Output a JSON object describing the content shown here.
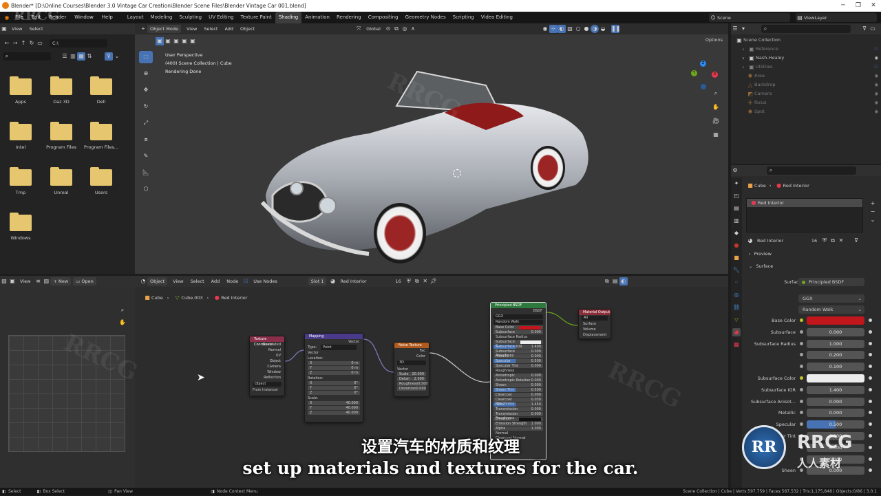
{
  "title_bar": {
    "text": "Blender* [D:\\Online Courses\\Blender 3.0 Vintage Car Creation\\Blender Scene Files\\Blender Vintage Car 001.blend]"
  },
  "menubar": {
    "menus": [
      "File",
      "Edit",
      "Render",
      "Window",
      "Help"
    ],
    "workspaces": [
      "Layout",
      "Modeling",
      "Sculpting",
      "UV Editing",
      "Texture Paint",
      "Shading",
      "Animation",
      "Rendering",
      "Compositing",
      "Geometry Nodes",
      "Scripting",
      "Video Editing"
    ],
    "active_workspace": "Shading",
    "scene": "Scene",
    "view_layer": "ViewLayer"
  },
  "file_browser": {
    "menu": [
      "View",
      "Select"
    ],
    "path": "C:\\",
    "folders": [
      "Apps",
      "Daz 3D",
      "Dell",
      "Intel",
      "Program Files",
      "Program Files...",
      "Tmp",
      "Unreal",
      "Users",
      "Windows"
    ]
  },
  "viewport": {
    "mode": "Object Mode",
    "menu": [
      "View",
      "Select",
      "Add",
      "Object"
    ],
    "transform": "Global",
    "options": "Options",
    "overlay_lines": [
      "User Perspective",
      "(400) Scene Collection | Cube",
      "Rendering Done"
    ],
    "gizmo_axes": {
      "x": "X",
      "y": "Y",
      "z": "Z"
    }
  },
  "outliner": {
    "root": "Scene Collection",
    "items": [
      "Reference",
      "Nash-Healey",
      "Utilities",
      "Area",
      "Backdrop",
      "Camera",
      "focus",
      "Spot"
    ]
  },
  "properties": {
    "breadcrumb": [
      "Cube",
      "Red Interior"
    ],
    "material_slot": "Red Interior",
    "material_name": "Red Interior",
    "users": "16",
    "sections": {
      "preview": "Preview",
      "surface": "Surface"
    },
    "surface_shader_label": "Surface",
    "surface_shader": "Principled BSDF",
    "distribution": "GGX",
    "subsurface_method": "Random Walk",
    "fields": [
      {
        "label": "Base Color",
        "type": "color",
        "color": "#c0161c"
      },
      {
        "label": "Subsurface",
        "value": "0.000"
      },
      {
        "label": "Subsurface Radius",
        "value": "1.000"
      },
      {
        "label": "",
        "value": "0.200"
      },
      {
        "label": "",
        "value": "0.100"
      },
      {
        "label": "Subsurface Color",
        "type": "color",
        "color": "#ececec"
      },
      {
        "label": "Subsurface IOR",
        "value": "1.400"
      },
      {
        "label": "Subsurface Anisot...",
        "value": "0.000"
      },
      {
        "label": "Metallic",
        "value": "0.000"
      },
      {
        "label": "Specular",
        "value": "0.500",
        "highlight": true
      },
      {
        "label": "Specular Tint",
        "value": "0.000"
      },
      {
        "label": "",
        "value": "0.000"
      },
      {
        "label": "",
        "value": "0.000"
      },
      {
        "label": "Sheen",
        "value": "0.000"
      }
    ]
  },
  "node_editor": {
    "object_menu": "Object",
    "menu": [
      "View",
      "Select",
      "Add",
      "Node"
    ],
    "use_nodes": "Use Nodes",
    "slot": "Slot 1",
    "material": "Red Interior",
    "users": "16",
    "breadcrumb": [
      "Cube",
      "Cube.003",
      "Red Interior"
    ],
    "nodes": {
      "texcoord": {
        "title": "Texture Coordinate",
        "outputs": [
          "Generated",
          "Normal",
          "UV",
          "Object",
          "Camera",
          "Window",
          "Reflection"
        ],
        "object": "Object",
        "from_instancer": "From Instancer"
      },
      "mapping": {
        "title": "Mapping",
        "output": "Vector",
        "type_label": "Type:",
        "type_value": "Point",
        "input": "Vector",
        "location": "Location:",
        "rotation": "Rotation:",
        "scale": "Scale:",
        "loc": [
          "0 m",
          "0 m",
          "0 m"
        ],
        "rot": [
          "0°",
          "0°",
          "0°"
        ],
        "scl": [
          "40.000",
          "40.000",
          "40.000"
        ],
        "axes": [
          "X",
          "Y",
          "Z"
        ]
      },
      "noise": {
        "title": "Noise Texture",
        "outputs": [
          "Fac",
          "Color"
        ],
        "dim": "3D",
        "input": "Vector",
        "params": [
          [
            "Scale",
            "20.000"
          ],
          [
            "Detail",
            "2.000"
          ],
          [
            "Roughness",
            "0.500"
          ],
          [
            "Distortion",
            "0.000"
          ]
        ]
      },
      "bsdf": {
        "title": "Principled BSDF",
        "output": "BSDF",
        "dist": "GGX",
        "method": "Random Walk",
        "rows": [
          [
            "Base Color",
            ""
          ],
          [
            "Subsurface",
            "0.000"
          ],
          [
            "Subsurface Radius",
            ""
          ],
          [
            "Subsurface C...",
            ""
          ],
          [
            "Subsurface IOR",
            "1.400"
          ],
          [
            "Subsurface Anisotropy",
            "0.000"
          ],
          [
            "Metallic",
            "0.000"
          ],
          [
            "Specular",
            "0.500"
          ],
          [
            "Specular Tint",
            "0.000"
          ],
          [
            "Roughness",
            ""
          ],
          [
            "Anisotropic",
            "0.000"
          ],
          [
            "Anisotropic Rotation",
            "0.000"
          ],
          [
            "Sheen",
            "0.000"
          ],
          [
            "Sheen Tint",
            "0.500"
          ],
          [
            "Clearcoat",
            "0.000"
          ],
          [
            "Clearcoat Roughness",
            "0.030"
          ],
          [
            "IOR",
            "1.450"
          ],
          [
            "Transmission",
            "0.000"
          ],
          [
            "Transmission Roughness",
            "0.000"
          ],
          [
            "Emission",
            ""
          ],
          [
            "Emission Strength",
            "1.000"
          ],
          [
            "Alpha",
            "1.000"
          ],
          [
            "Normal",
            ""
          ],
          [
            "Clearcoat Normal",
            ""
          ]
        ]
      },
      "output": {
        "title": "Material Output",
        "target": "All",
        "inputs": [
          "Surface",
          "Volume",
          "Displacement"
        ]
      }
    }
  },
  "left_bottom": {
    "menu": [
      "View"
    ],
    "new_label": "New",
    "open_label": "Open"
  },
  "status_bar": {
    "left": [
      "Select",
      "Box Select",
      "Pan View",
      "Node Context Menu"
    ],
    "right": "Scene Collection | Cube | Verts:597,759 | Faces:587,532 | Tris:1,175,848 | Objects:0/86 | 3.0.1"
  },
  "subtitles": {
    "cn": "设置汽车的材质和纹理",
    "en": "set up materials and textures for the car."
  },
  "watermark": {
    "brand": "RRCG",
    "cn": "人人素材"
  },
  "colors": {
    "accent": "#4772b3",
    "base_color": "#c0161c",
    "folder": "#e6c66f"
  }
}
